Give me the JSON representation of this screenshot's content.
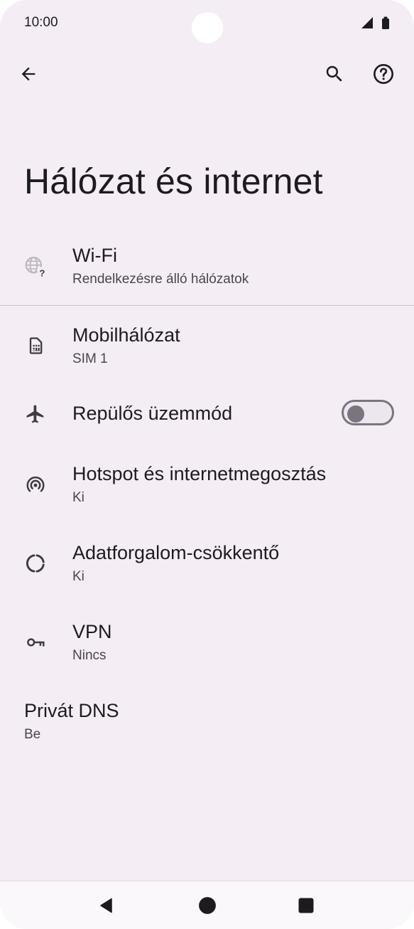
{
  "status_bar": {
    "time": "10:00",
    "icons": [
      "signal-icon",
      "battery-icon"
    ]
  },
  "app_bar": {
    "back_icon": "back-arrow-icon",
    "search_icon": "search-icon",
    "help_icon": "help-icon"
  },
  "page": {
    "title": "Hálózat és internet"
  },
  "settings": {
    "wifi": {
      "title": "Wi-Fi",
      "subtitle": "Rendelkezésre álló hálózatok",
      "icon": "wifi-unknown-icon"
    },
    "mobile": {
      "title": "Mobilhálózat",
      "subtitle": "SIM 1",
      "icon": "sim-card-icon"
    },
    "airplane": {
      "title": "Repülős üzemmód",
      "icon": "airplane-icon",
      "toggle_on": false
    },
    "hotspot": {
      "title": "Hotspot és internetmegosztás",
      "subtitle": "Ki",
      "icon": "hotspot-icon"
    },
    "datasaver": {
      "title": "Adatforgalom-csökkentő",
      "subtitle": "Ki",
      "icon": "data-saver-icon"
    },
    "vpn": {
      "title": "VPN",
      "subtitle": "Nincs",
      "icon": "key-icon"
    },
    "dns": {
      "title": "Privát DNS",
      "subtitle": "Be"
    }
  },
  "nav_bar": {
    "icons": [
      "nav-back-icon",
      "nav-home-icon",
      "nav-recents-icon"
    ]
  },
  "colors": {
    "background": "#f4eef4",
    "text": "#1d1b20",
    "secondary_text": "#49454f",
    "icon": "#3f3b44"
  }
}
